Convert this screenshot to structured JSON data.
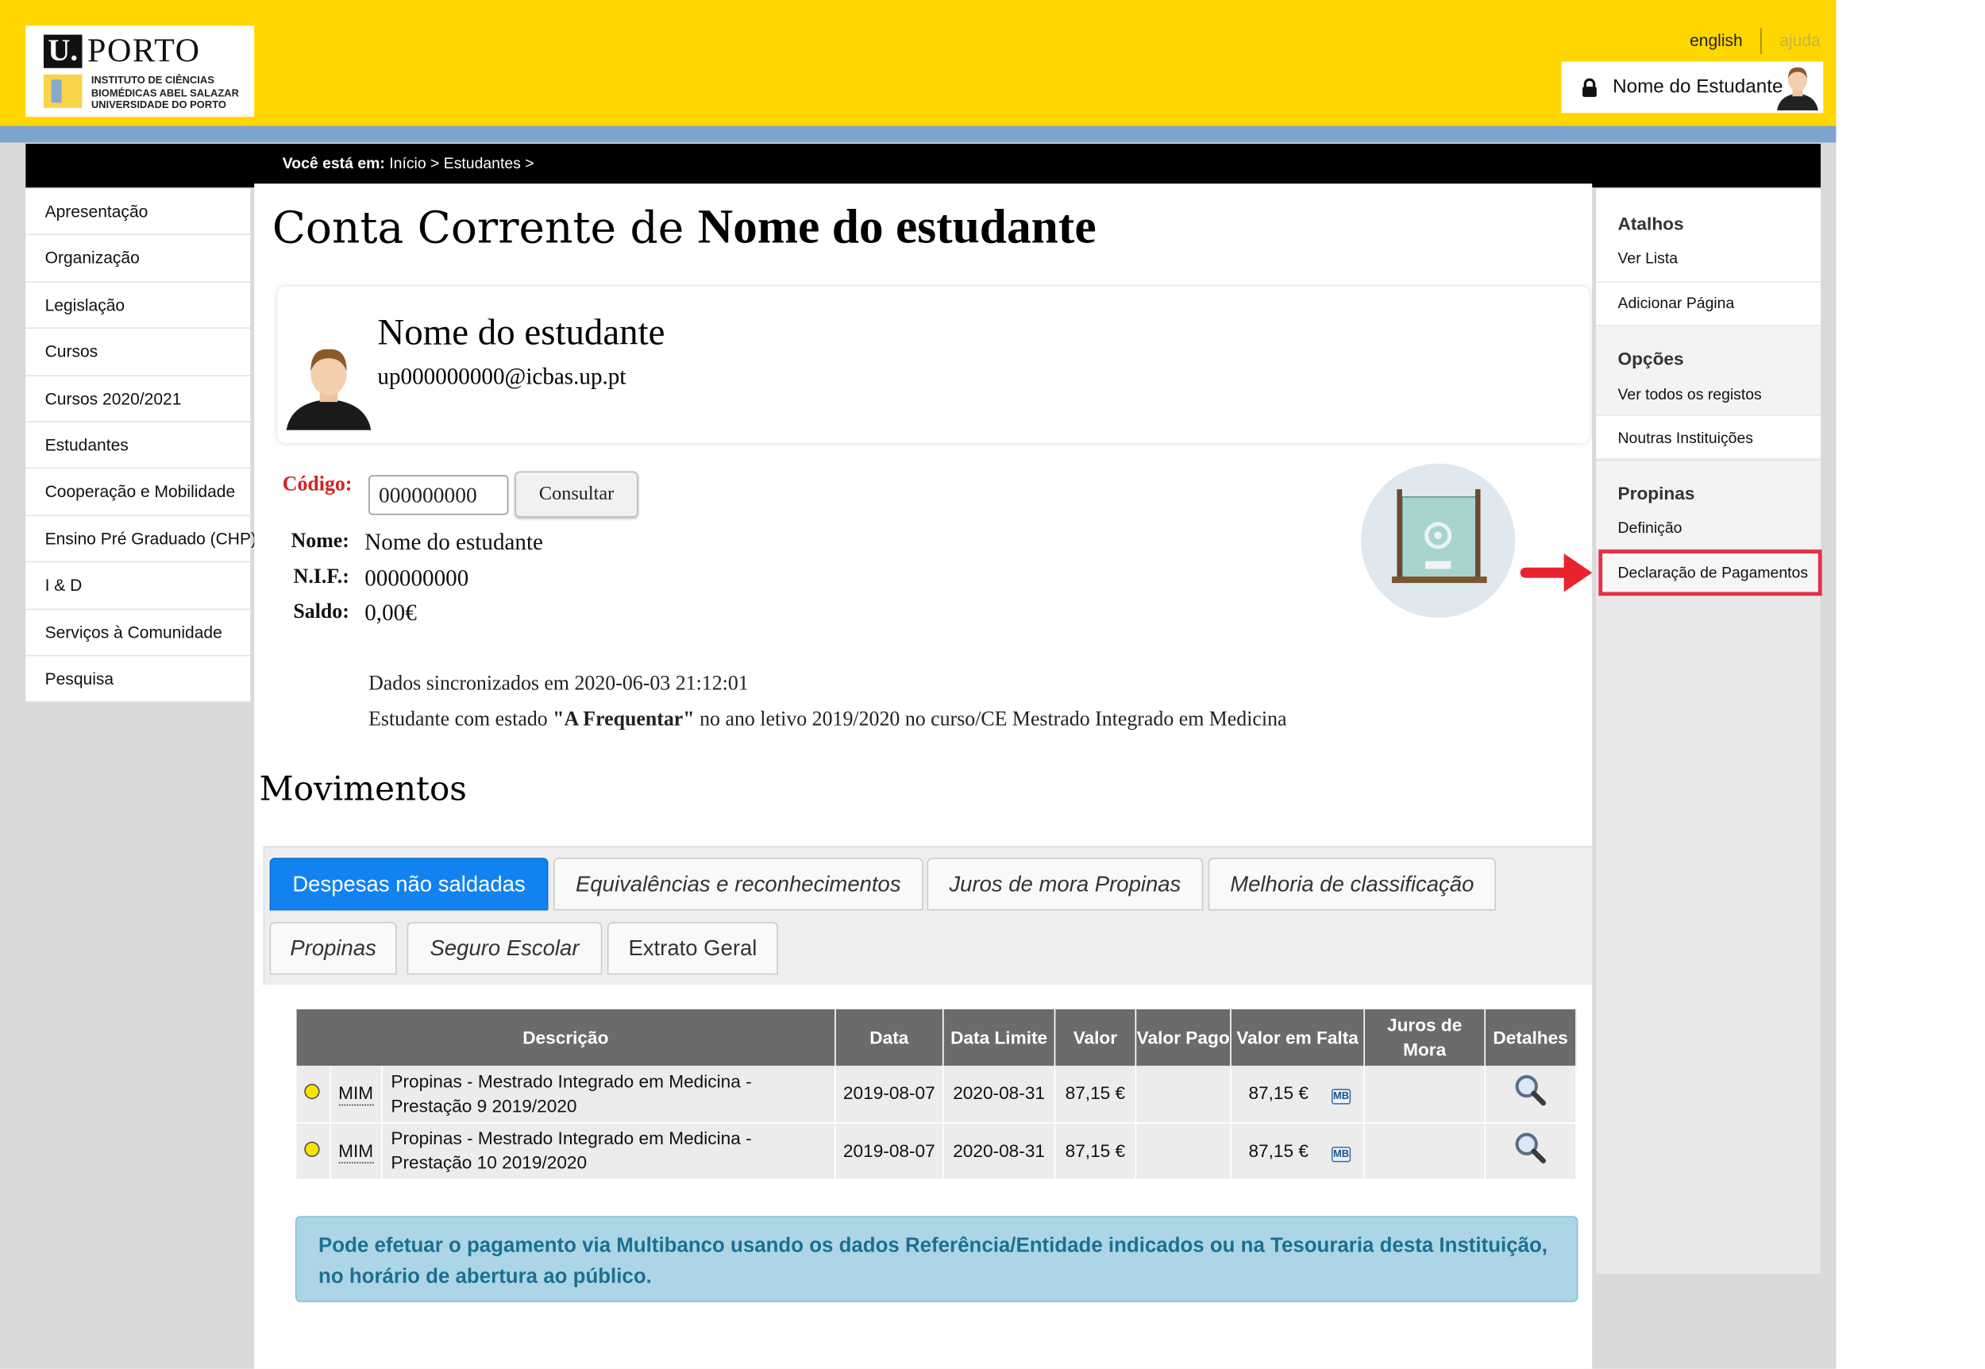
{
  "header": {
    "logo": {
      "u": "U.",
      "porto": "PORTO",
      "subtitle": "INSTITUTO DE CIÊNCIAS\nBIOMÉDICAS ABEL SALAZAR\nUNIVERSIDADE DO PORTO"
    },
    "language_link": "english",
    "help_link": "ajuda",
    "user_name": "Nome do Estudante"
  },
  "breadcrumb": {
    "prefix": "Você está em:",
    "path": "Início > Estudantes >"
  },
  "left_nav": [
    {
      "label": "Apresentação"
    },
    {
      "label": "Organização"
    },
    {
      "label": "Legislação"
    },
    {
      "label": "Cursos"
    },
    {
      "label": "Cursos 2020/2021"
    },
    {
      "label": "Estudantes"
    },
    {
      "label": "Cooperação e Mobilidade"
    },
    {
      "label": "Ensino Pré Graduado (CHP)"
    },
    {
      "label": "I & D"
    },
    {
      "label": "Serviços à Comunidade"
    },
    {
      "label": "Pesquisa"
    }
  ],
  "main": {
    "title_prefix": "Conta Corrente de",
    "title_name": "Nome do estudante",
    "profile": {
      "name": "Nome do estudante",
      "email": "up000000000@icbas.up.pt"
    },
    "code_label": "Código:",
    "code_value": "000000000",
    "consult_button": "Consultar",
    "name_label": "Nome:",
    "name_value": "Nome do estudante",
    "nif_label": "N.I.F.:",
    "nif_value": "000000000",
    "balance_label": "Saldo:",
    "balance_value": "0,00€",
    "sync_text": "Dados sincronizados em 2020-06-03 21:12:01",
    "status_prefix": "Estudante com estado ",
    "status_state": "\"A Frequentar\"",
    "status_suffix": " no ano letivo 2019/2020 no curso/CE Mestrado Integrado em Medicina",
    "movements_title": "Movimentos"
  },
  "tabs": [
    {
      "label": "Despesas não saldadas"
    },
    {
      "label": "Equivalências e reconhecimentos"
    },
    {
      "label": "Juros de mora Propinas"
    },
    {
      "label": "Melhoria de classificação"
    },
    {
      "label": "Propinas"
    },
    {
      "label": "Seguro Escolar"
    },
    {
      "label": "Extrato Geral"
    }
  ],
  "table": {
    "headers": {
      "descricao": "Descrição",
      "data": "Data",
      "data_limite": "Data Limite",
      "valor": "Valor",
      "valor_pago": "Valor Pago",
      "valor_em_falta": "Valor em Falta",
      "juros_de_mora": "Juros de Mora",
      "detalhes": "Detalhes"
    },
    "rows": [
      {
        "code": "MIM",
        "descricao": "Propinas - Mestrado Integrado em Medicina - Prestação 9 2019/2020",
        "data": "2019-08-07",
        "data_limite": "2020-08-31",
        "valor": "87,15 €",
        "valor_pago": "",
        "valor_em_falta": "87,15 €",
        "mb": "MB",
        "juros_de_mora": ""
      },
      {
        "code": "MIM",
        "descricao": "Propinas - Mestrado Integrado em Medicina - Prestação 10 2019/2020",
        "data": "2019-08-07",
        "data_limite": "2020-08-31",
        "valor": "87,15 €",
        "valor_pago": "",
        "valor_em_falta": "87,15 €",
        "mb": "MB",
        "juros_de_mora": ""
      }
    ]
  },
  "info_message": "Pode efetuar o pagamento via Multibanco usando os dados Referência/Entidade indicados ou na Tesouraria desta Instituição, no horário de abertura ao público.",
  "right_panel": {
    "atalhos": {
      "heading": "Atalhos",
      "ver_lista": "Ver Lista",
      "adicionar_pagina": "Adicionar Página"
    },
    "opcoes": {
      "heading": "Opções",
      "ver_todos": "Ver todos os registos",
      "noutras": "Noutras Instituições"
    },
    "propinas": {
      "heading": "Propinas",
      "definicao": "Definição",
      "declaracao": "Declaração de Pagamentos"
    }
  },
  "colors": {
    "header_yellow": "#ffd600",
    "active_tab_blue": "#1282f0",
    "code_label_red": "#d42020",
    "highlight_red": "#e53048",
    "info_box_blue": "#acd6e6"
  }
}
